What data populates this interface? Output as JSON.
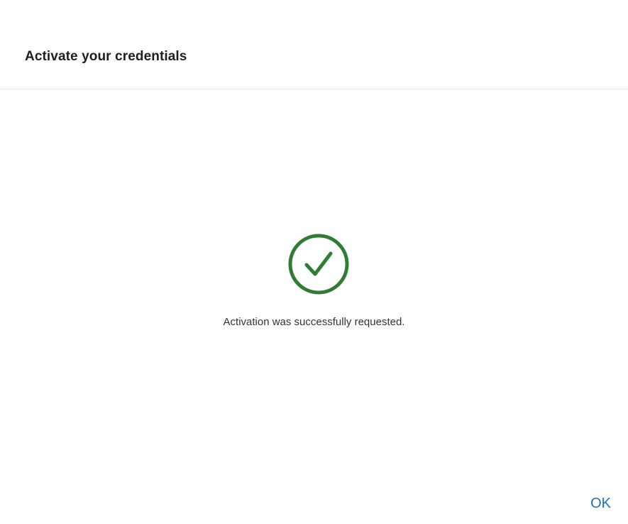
{
  "dialog": {
    "title": "Activate your credentials",
    "status_message": "Activation was successfully requested.",
    "status_icon": "check-circle-icon",
    "ok_label": "OK"
  },
  "colors": {
    "success": "#2e7d32",
    "link": "#1f6fb5",
    "divider": "#e6e6e6"
  }
}
